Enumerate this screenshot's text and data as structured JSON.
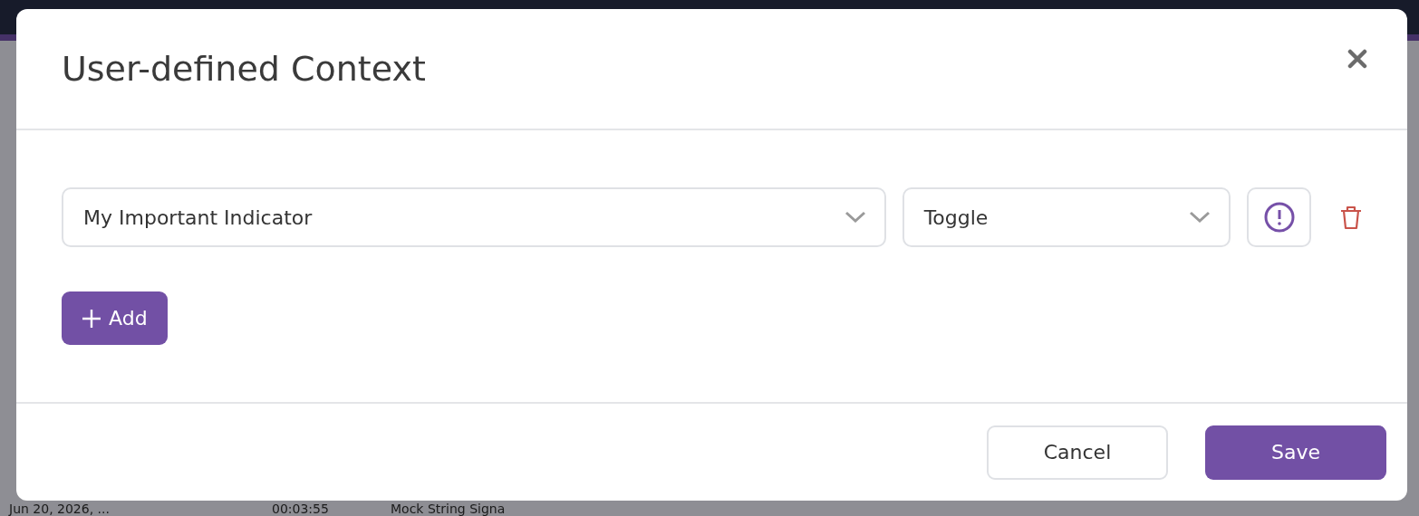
{
  "background": {
    "rows": [
      {
        "cells": [
          "Jun 20, 2026, ...",
          "00:03:55",
          "Mock String Signa"
        ]
      }
    ]
  },
  "dialog": {
    "title": "User-defined Context",
    "entries": [
      {
        "name": "My Important Indicator",
        "type": "Toggle"
      }
    ],
    "add_label": "Add",
    "buttons": [
      {
        "label": "Cancel",
        "kind": "secondary"
      },
      {
        "label": "Save",
        "kind": "primary"
      }
    ]
  }
}
